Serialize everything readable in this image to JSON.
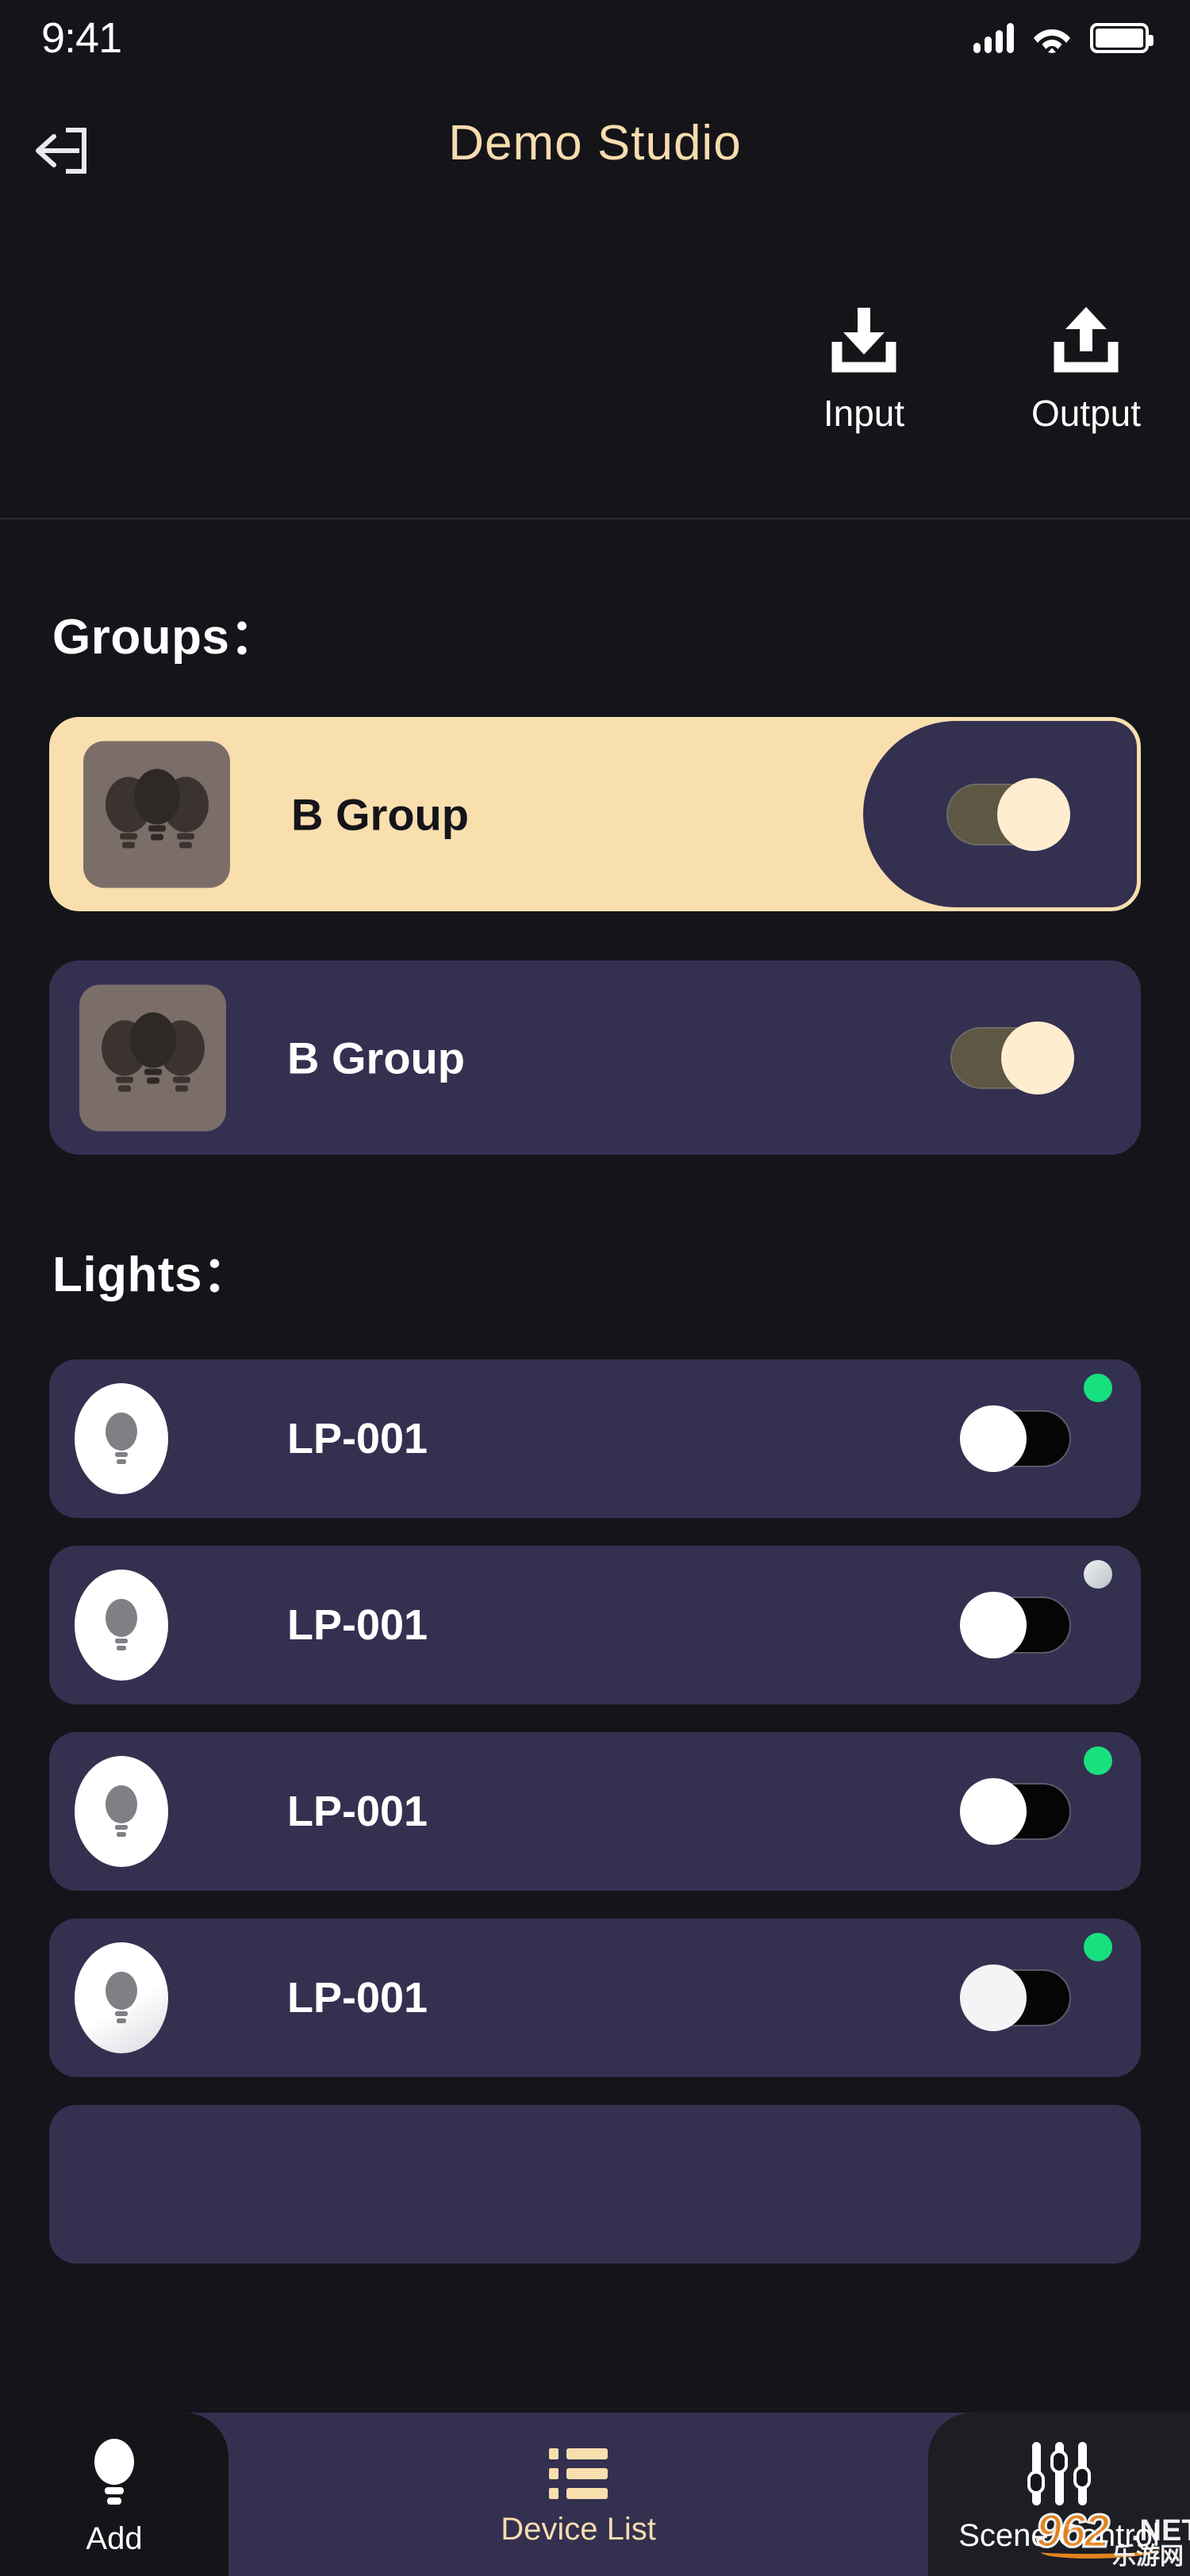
{
  "status_bar": {
    "time": "9:41",
    "icons": [
      "signal-icon",
      "wifi-icon",
      "battery-icon"
    ]
  },
  "header": {
    "back_icon": "back-arrow-icon",
    "title": "Demo Studio",
    "actions": [
      {
        "label": "Input",
        "icon": "download-icon"
      },
      {
        "label": "Output",
        "icon": "upload-icon"
      }
    ]
  },
  "sections": {
    "groups_title": "Groups：",
    "lights_title": "Lights："
  },
  "groups": [
    {
      "name": "B Group",
      "icon": "bulb-group-icon",
      "selected": true,
      "toggle": "on"
    },
    {
      "name": "B Group",
      "icon": "bulb-group-icon",
      "selected": false,
      "toggle": "on"
    }
  ],
  "lights": [
    {
      "name": "LP-001",
      "icon": "bulb-icon",
      "toggle": "off",
      "status": "online",
      "status_color": "#17e07f"
    },
    {
      "name": "LP-001",
      "icon": "bulb-icon",
      "toggle": "off",
      "status": "offline",
      "status_color": "#c8d0d5"
    },
    {
      "name": "LP-001",
      "icon": "bulb-icon",
      "toggle": "off",
      "status": "online",
      "status_color": "#17e07f"
    },
    {
      "name": "LP-001",
      "icon": "bulb-icon",
      "toggle": "off",
      "status": "online",
      "status_color": "#17e07f"
    }
  ],
  "bottom_nav": [
    {
      "label": "Add",
      "icon": "bulb-icon",
      "active": true
    },
    {
      "label": "Device List",
      "icon": "list-icon",
      "active": false
    },
    {
      "label": "Scene Control",
      "icon": "sliders-icon",
      "active": true
    }
  ],
  "watermark": {
    "brand": "962",
    "tld": ".NET",
    "cn": "乐游网"
  },
  "colors": {
    "background": "#14141a",
    "card": "#343050",
    "accent": "#f9dfae",
    "title": "#f6dcae",
    "online": "#17e07f"
  }
}
